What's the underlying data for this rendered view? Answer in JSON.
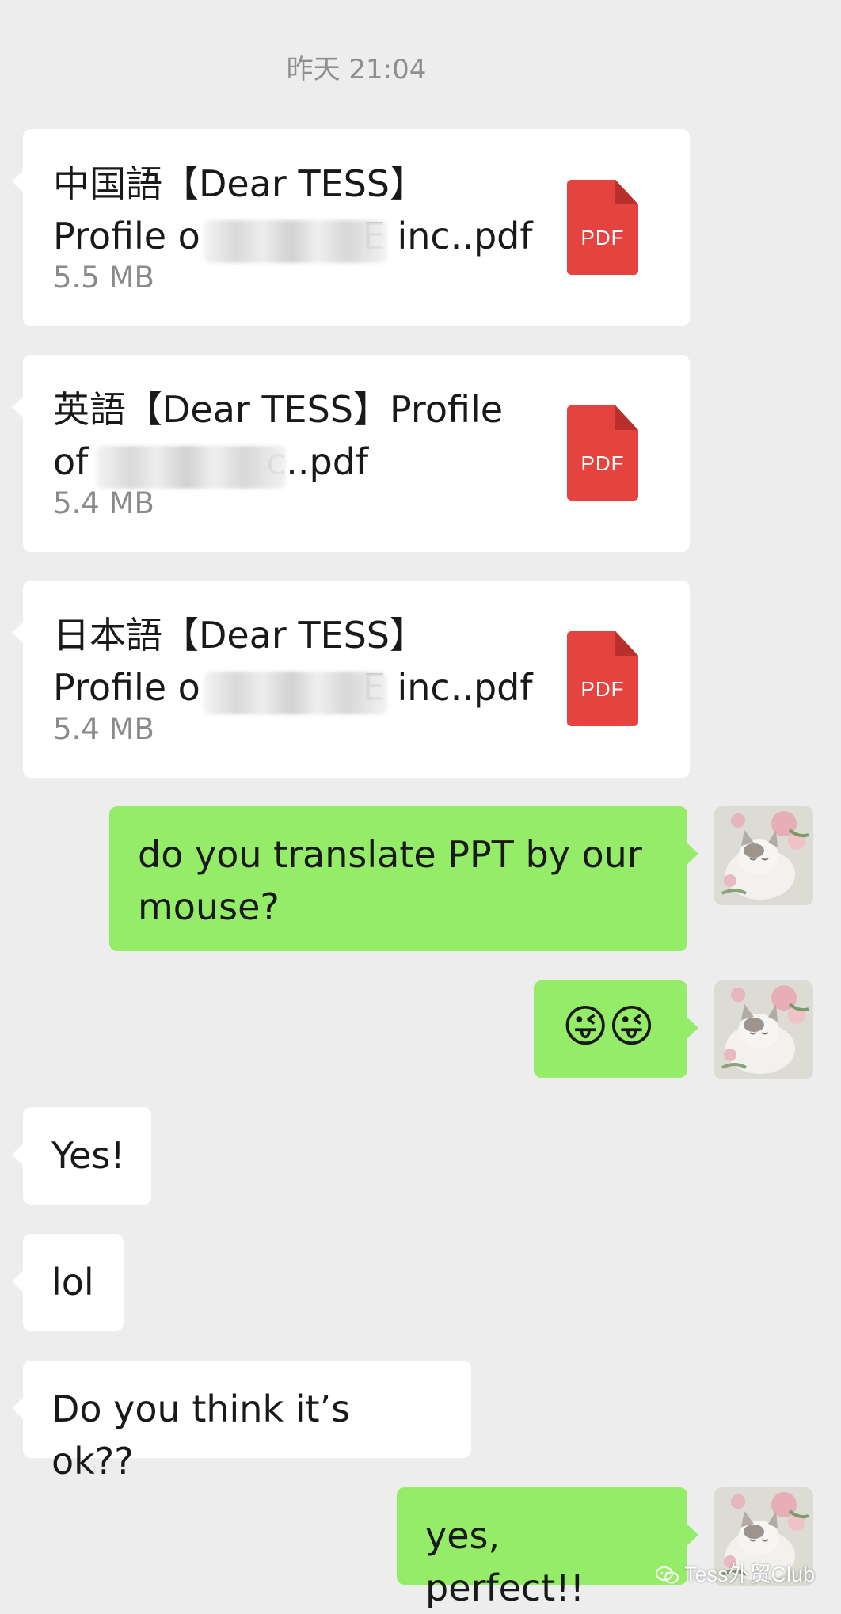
{
  "chat": {
    "timestamp": "昨天 21:04",
    "files": [
      {
        "name": "中国語【Dear TESS】Profile of ██████E inc..pdf",
        "name_visible_lead": "中国語【Dear TESS】",
        "name_visible_line2": "Profile o",
        "name_visible_tail": "E inc..pdf",
        "size": "5.5 MB",
        "icon": "pdf-icon",
        "icon_label": "PDF"
      },
      {
        "name": "英語【Dear TESS】Profile of ██████ inc..pdf",
        "name_visible_lead": "英語【Dear TESS】Profile",
        "name_visible_line2": "of ",
        "name_visible_tail": "c..pdf",
        "size": "5.4 MB",
        "icon": "pdf-icon",
        "icon_label": "PDF"
      },
      {
        "name": "日本語【Dear TESS】Profile of ██████E inc..pdf",
        "name_visible_lead": "日本語【Dear TESS】",
        "name_visible_line2": "Profile o",
        "name_visible_tail": "E inc..pdf",
        "size": "5.4 MB",
        "icon": "pdf-icon",
        "icon_label": "PDF"
      }
    ],
    "messages": [
      {
        "direction": "out",
        "text": "do you translate PPT by our mouse?"
      },
      {
        "direction": "out",
        "text": "😜😜",
        "kind": "emoji",
        "emoji_name": "winking-tongue-face"
      },
      {
        "direction": "in",
        "text": "Yes!"
      },
      {
        "direction": "in",
        "text": "lol"
      },
      {
        "direction": "in",
        "text": "Do you think it’s ok??"
      },
      {
        "direction": "out",
        "text": "yes, perfect!!"
      }
    ],
    "self_avatar": "cat-with-flowers-avatar",
    "colors": {
      "background": "#ededed",
      "incoming_bubble": "#ffffff",
      "outgoing_bubble": "#95ec69",
      "pdf_icon": "#e5433f",
      "timestamp_text": "#8f8f8f"
    }
  },
  "watermark": {
    "text": "Tess外贸Club",
    "icon": "wechat-icon"
  }
}
